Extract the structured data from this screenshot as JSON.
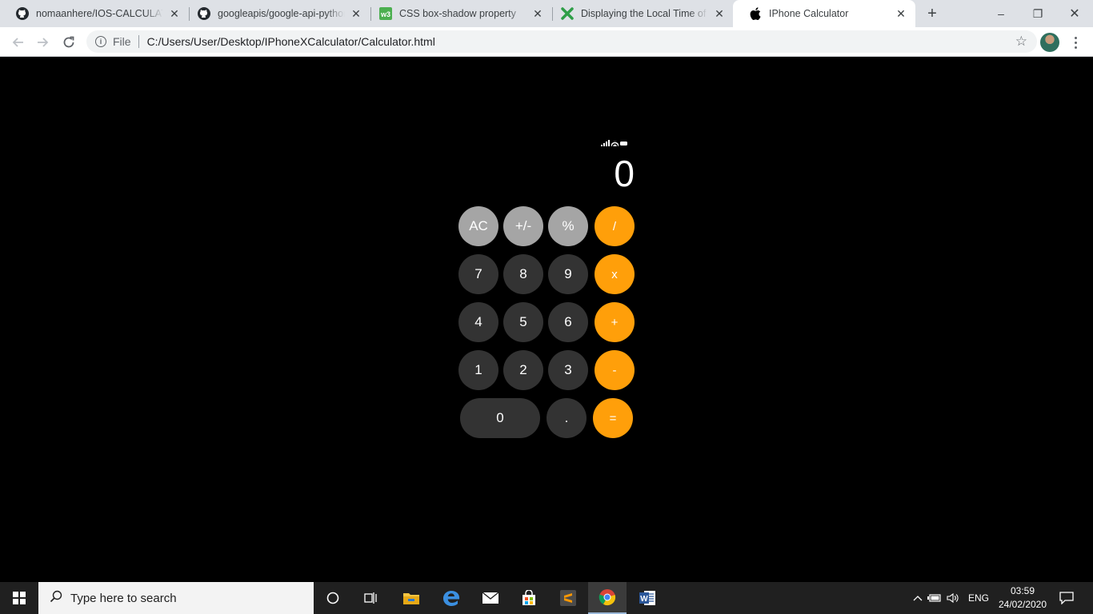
{
  "browser": {
    "tabs": [
      {
        "title": "nomaanhere/IOS-CALCULATOR",
        "icon": "github-icon"
      },
      {
        "title": "googleapis/google-api-python-client",
        "icon": "github-icon"
      },
      {
        "title": "CSS box-shadow property",
        "icon": "w3schools-icon"
      },
      {
        "title": "Displaying the Local Time of Any City",
        "icon": "xpertdev-icon"
      },
      {
        "title": "IPhone Calculator",
        "icon": "apple-icon",
        "active": true
      }
    ],
    "window_controls": {
      "minimize": "–",
      "maximize": "❐",
      "close": "✕"
    },
    "address": {
      "scheme": "File",
      "url": "C:/Users/User/Desktop/IPhoneXCalculator/Calculator.html"
    }
  },
  "calculator": {
    "display": "0",
    "colors": {
      "function": "#a5a5a5",
      "number": "#333333",
      "operator": "#ff9f0a",
      "background": "#000000"
    },
    "rows": [
      [
        {
          "label": "AC",
          "kind": "fn"
        },
        {
          "label": "+/-",
          "kind": "fn"
        },
        {
          "label": "%",
          "kind": "fn"
        },
        {
          "label": "/",
          "kind": "op"
        }
      ],
      [
        {
          "label": "7",
          "kind": "num"
        },
        {
          "label": "8",
          "kind": "num"
        },
        {
          "label": "9",
          "kind": "num"
        },
        {
          "label": "x",
          "kind": "op"
        }
      ],
      [
        {
          "label": "4",
          "kind": "num"
        },
        {
          "label": "5",
          "kind": "num"
        },
        {
          "label": "6",
          "kind": "num"
        },
        {
          "label": "+",
          "kind": "op"
        }
      ],
      [
        {
          "label": "1",
          "kind": "num"
        },
        {
          "label": "2",
          "kind": "num"
        },
        {
          "label": "3",
          "kind": "num"
        },
        {
          "label": "-",
          "kind": "op"
        }
      ],
      [
        {
          "label": "0",
          "kind": "num"
        },
        {
          "label": ".",
          "kind": "num"
        },
        {
          "label": "=",
          "kind": "op"
        }
      ]
    ]
  },
  "taskbar": {
    "search_placeholder": "Type here to search",
    "language": "ENG",
    "time": "03:59",
    "date": "24/02/2020"
  }
}
